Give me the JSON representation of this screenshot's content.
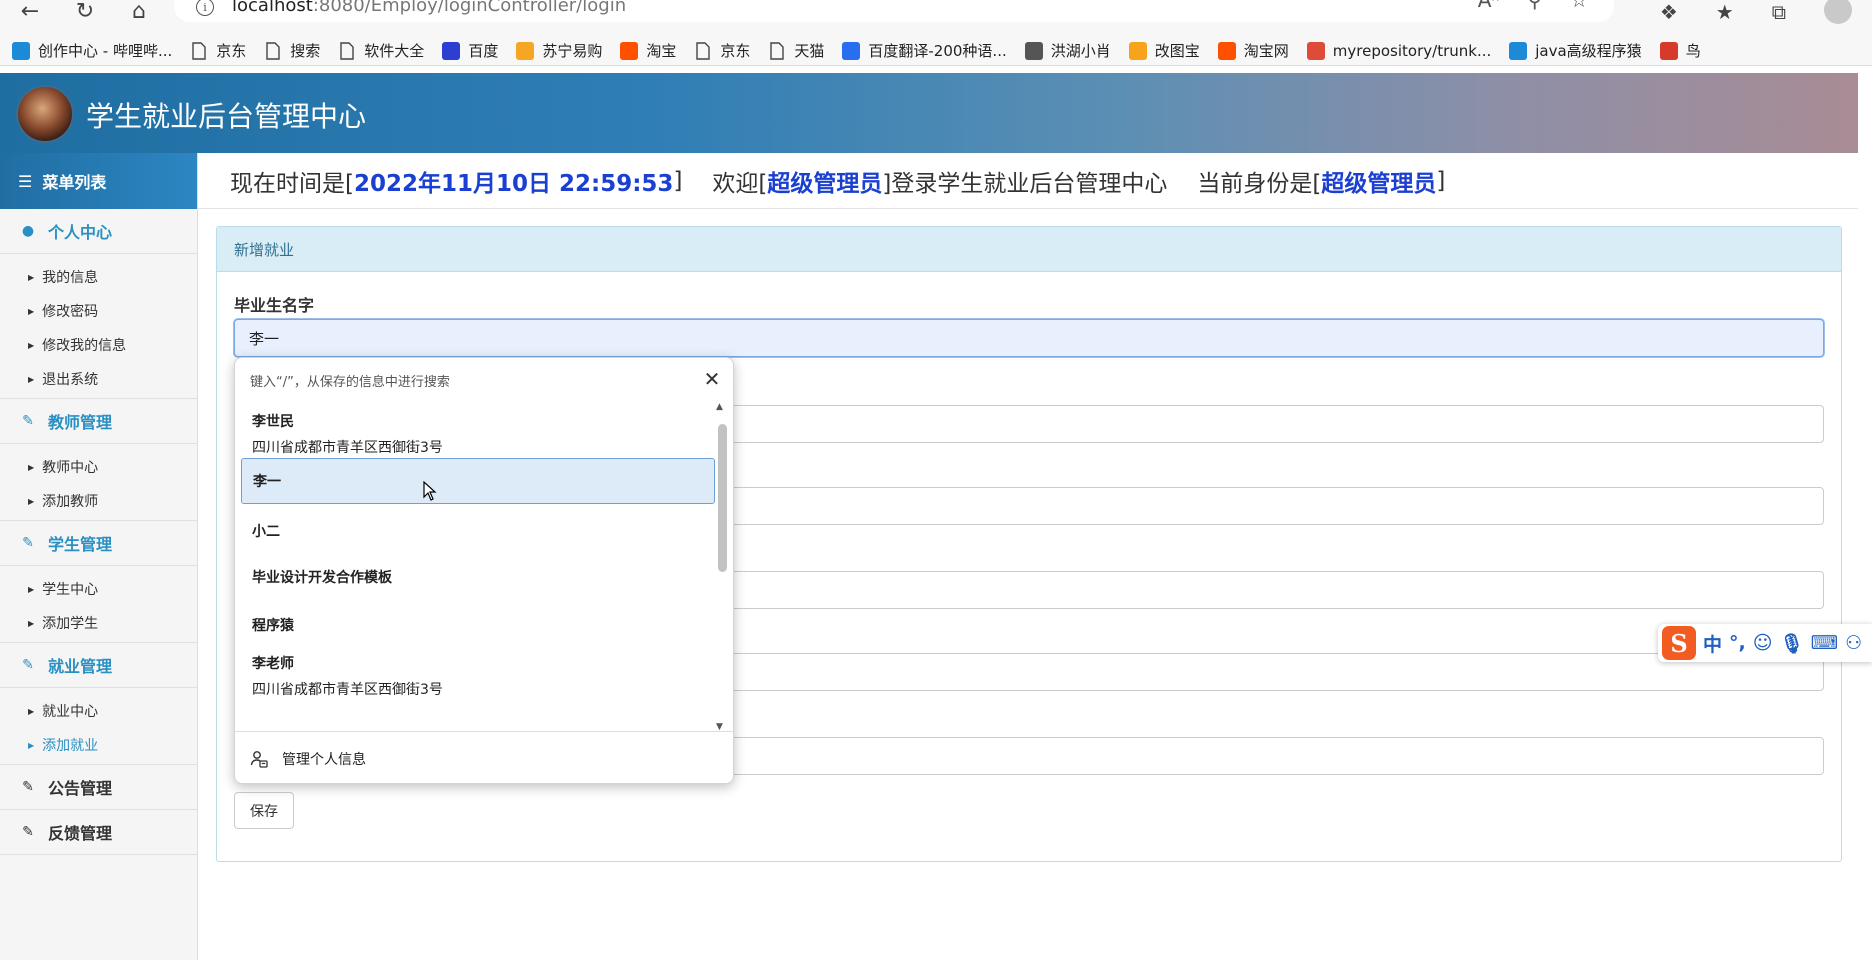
{
  "browser": {
    "url_host": "localhost",
    "url_path": ":8080/Employ/loginController/login",
    "bookmarks": [
      {
        "label": "创作中心 - 哔哩哔...",
        "icon": "bilibili-icon",
        "color": "#1c8ad6"
      },
      {
        "label": "京东",
        "icon": "page-icon",
        "color": ""
      },
      {
        "label": "搜索",
        "icon": "page-icon",
        "color": ""
      },
      {
        "label": "软件大全",
        "icon": "page-icon",
        "color": ""
      },
      {
        "label": "百度",
        "icon": "baidu-paw-icon",
        "color": "#2c3fd1"
      },
      {
        "label": "苏宁易购",
        "icon": "suning-icon",
        "color": "#f5a623"
      },
      {
        "label": "淘宝",
        "icon": "taobao-icon",
        "color": "#ff5000"
      },
      {
        "label": "京东",
        "icon": "page-icon",
        "color": ""
      },
      {
        "label": "天猫",
        "icon": "page-icon",
        "color": ""
      },
      {
        "label": "百度翻译-200种语...",
        "icon": "translate-icon",
        "color": "#2a6ef0"
      },
      {
        "label": "洪湖小肖",
        "icon": "bird-icon",
        "color": "#555555"
      },
      {
        "label": "改图宝",
        "icon": "gaitubao-icon",
        "color": "#f7a31c"
      },
      {
        "label": "淘宝网",
        "icon": "taobao-icon",
        "color": "#ff5000"
      },
      {
        "label": "myrepository/trunk...",
        "icon": "chrome-icon",
        "color": "#de4b39"
      },
      {
        "label": "java高级程序猿",
        "icon": "bilibili-icon",
        "color": "#1c8ad6"
      },
      {
        "label": "鸟",
        "icon": "bird-icon",
        "color": "#d63a2b"
      }
    ]
  },
  "header": {
    "title": "学生就业后台管理中心"
  },
  "sidebar": {
    "menu_title": "菜单列表",
    "groups": [
      {
        "label": "个人中心",
        "icon": "user-icon",
        "items": [
          "我的信息",
          "修改密码",
          "修改我的信息",
          "退出系统"
        ]
      },
      {
        "label": "教师管理",
        "icon": "edit-icon",
        "items": [
          "教师中心",
          "添加教师"
        ]
      },
      {
        "label": "学生管理",
        "icon": "edit-icon",
        "items": [
          "学生中心",
          "添加学生"
        ]
      },
      {
        "label": "就业管理",
        "icon": "edit-icon",
        "items": [
          "就业中心",
          "添加就业"
        ]
      },
      {
        "label": "公告管理",
        "icon": "edit-icon",
        "items": []
      },
      {
        "label": "反馈管理",
        "icon": "edit-icon",
        "items": []
      }
    ],
    "active_item": "添加就业"
  },
  "infobar": {
    "time_prefix": "现在时间是[",
    "time_value": "2022年11月10日 22:59:53",
    "time_suffix": "]",
    "welcome_prefix": "欢迎[",
    "welcome_user": "超级管理员",
    "welcome_suffix": "]登录学生就业后台管理中心",
    "role_prefix": "当前身份是[",
    "role_value": "超级管理员",
    "role_suffix": "]"
  },
  "form": {
    "panel_title": "新增就业",
    "field_label": "毕业生名字",
    "field_value": "李一",
    "save_label": "保存"
  },
  "autofill": {
    "hint": "键入“/”，从保存的信息中进行搜索",
    "items": [
      {
        "name": "李世民",
        "addr": "四川省成都市青羊区西御街3号"
      },
      {
        "name": "李一",
        "addr": ""
      },
      {
        "name": "小二",
        "addr": ""
      },
      {
        "name": "毕业设计开发合作模板",
        "addr": ""
      },
      {
        "name": "程序猿",
        "addr": ""
      },
      {
        "name": "李老师",
        "addr": "四川省成都市青羊区西御街3号"
      }
    ],
    "selected_item": "李一",
    "footer": "管理个人信息"
  },
  "ime": {
    "mode": "中",
    "punct": "°,"
  }
}
